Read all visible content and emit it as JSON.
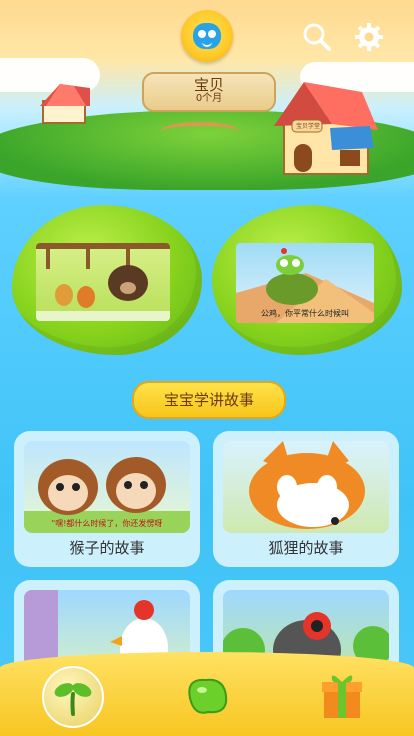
{
  "header": {
    "profile": {
      "name": "宝贝",
      "age": "0个月"
    },
    "icons": {
      "search": "search-icon",
      "settings": "gear-icon"
    },
    "house_sign": "宝贝学堂"
  },
  "featured": [
    {
      "name": "featured-video-1"
    },
    {
      "name": "featured-video-2",
      "caption": "公鸡，你平常什么时候叫"
    }
  ],
  "section": {
    "title": "宝宝学讲故事"
  },
  "stories": [
    {
      "label": "猴子的故事",
      "caption": "\"嘿!都什么时候了，你还发愣呀"
    },
    {
      "label": "狐狸的故事"
    },
    {
      "label": ""
    },
    {
      "label": ""
    }
  ],
  "bottom_nav": [
    {
      "name": "sprout-icon",
      "active": true
    },
    {
      "name": "bean-icon",
      "active": false
    },
    {
      "name": "gift-icon",
      "active": false
    }
  ],
  "colors": {
    "sky": "#3fc3f7",
    "accent_green": "#86d21c",
    "accent_yellow": "#f7c51b",
    "card_bg": "#cdf0fd"
  }
}
